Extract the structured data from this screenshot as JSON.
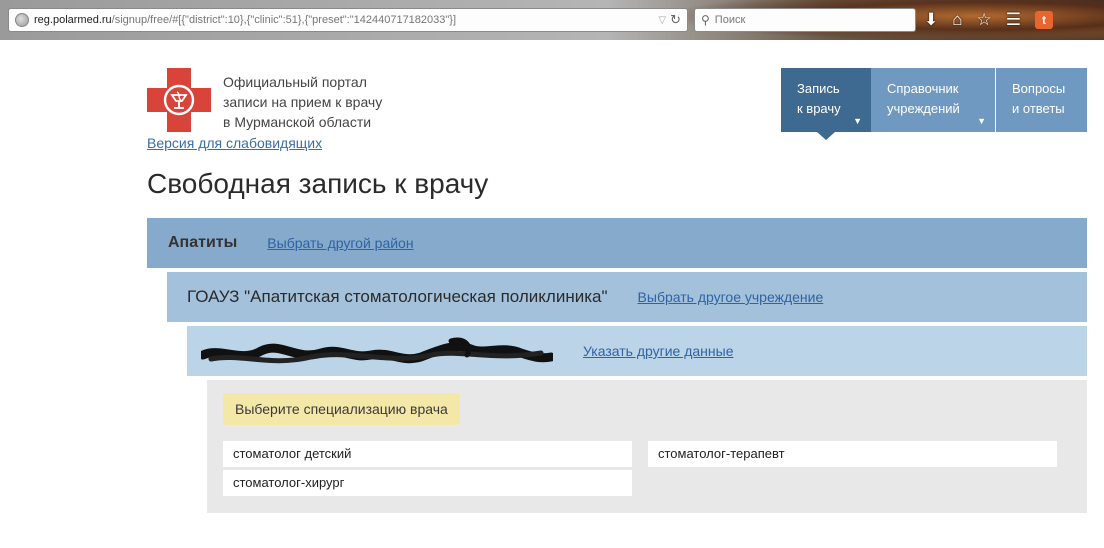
{
  "browser": {
    "url_host": "reg.polarmed.ru",
    "url_path": "/signup/free/#[{\"district\":10},{\"clinic\":51},{\"preset\":\"142440717182033\"}]",
    "search_placeholder": "Поиск",
    "icons": [
      "globe-icon",
      "reload-icon",
      "search-icon",
      "download-icon",
      "home-icon",
      "bookmark-star-icon",
      "reading-list-icon",
      "addon-icon"
    ]
  },
  "header": {
    "portal_title_lines": [
      "Официальный портал",
      "записи на прием к врачу",
      "в Мурманской области"
    ],
    "vision_link": "Версия для слабовидящих",
    "logo_colors": {
      "cross": "#d9443a",
      "emblem": "#ffffff"
    }
  },
  "nav": [
    {
      "line1": "Запись",
      "line2": "к врачу",
      "active": true,
      "has_dropdown": true
    },
    {
      "line1": "Справочник",
      "line2": "учреждений",
      "active": false,
      "has_dropdown": true
    },
    {
      "line1": "Вопросы",
      "line2": "и ответы",
      "active": false,
      "has_dropdown": false
    }
  ],
  "page_title": "Свободная запись к врачу",
  "steps": {
    "district": {
      "value": "Апатиты",
      "change_link": "Выбрать другой район"
    },
    "clinic": {
      "value": "ГОАУЗ \"Апатитская стоматологическая поликлиника\"",
      "change_link": "Выбрать другое учреждение"
    },
    "personal": {
      "value_redacted": true,
      "change_link": "Указать другие данные"
    }
  },
  "specialization": {
    "prompt": "Выберите специализацию врача",
    "options": [
      "стоматолог детский",
      "стоматолог-терапевт",
      "стоматолог-хирург"
    ]
  },
  "colors": {
    "nav_active": "#3e6a92",
    "nav_inactive": "#6f99c0",
    "step1_bg": "#86aacb",
    "step2_bg": "#a4c1dc",
    "step3_bg": "#bcd4e8",
    "prompt_bg": "#f4e8a8",
    "link": "#2f63a3"
  }
}
